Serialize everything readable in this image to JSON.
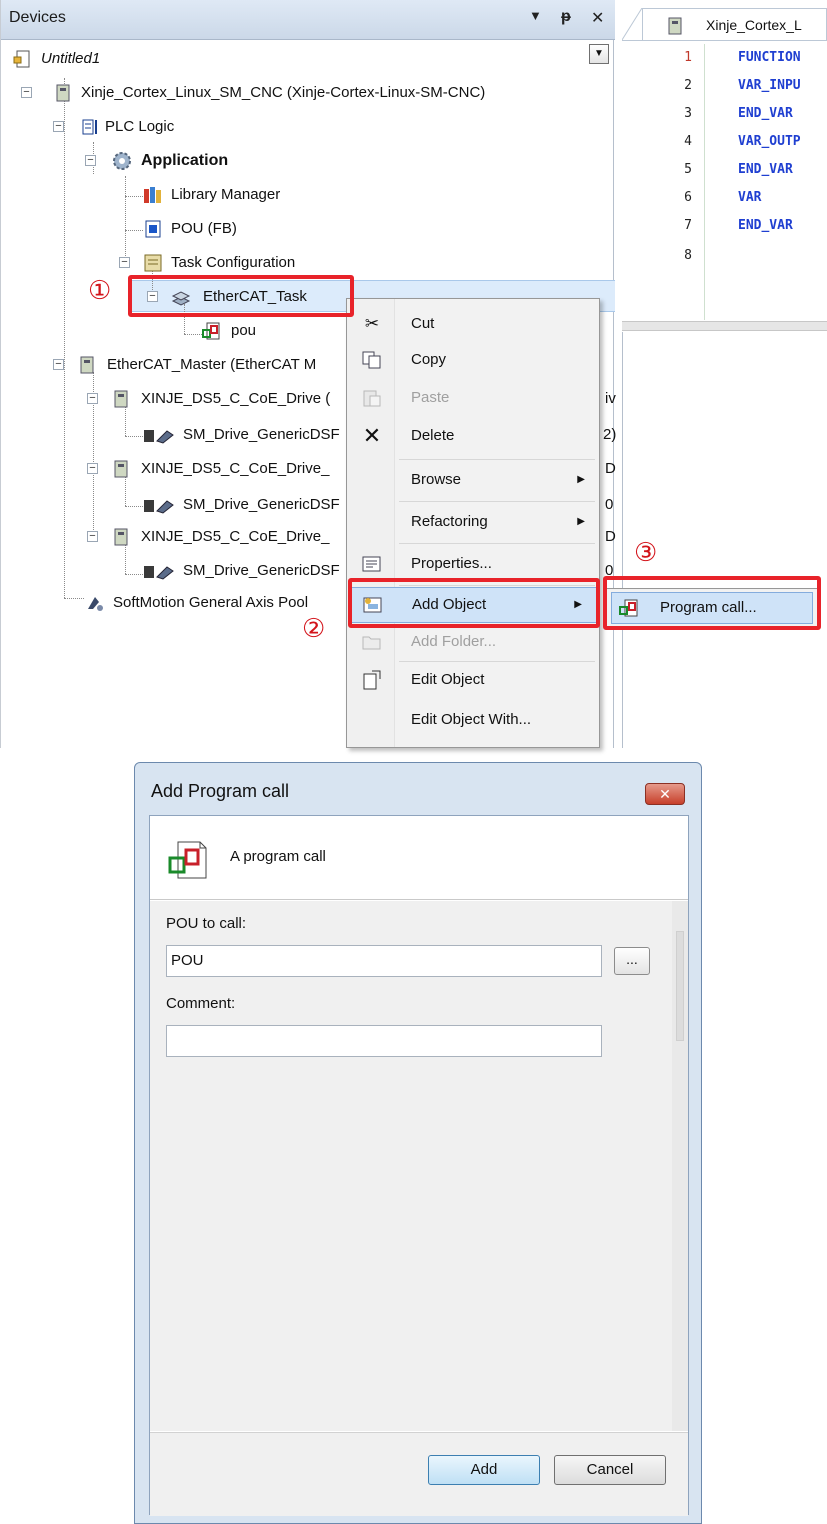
{
  "devices_panel": {
    "title": "Devices",
    "pin_glyph": "⬇ ґ",
    "close_glyph": "✕",
    "tree": {
      "untitled": "Untitled1",
      "device": "Xinje_Cortex_Linux_SM_CNC (Xinje-Cortex-Linux-SM-CNC)",
      "plc_logic": "PLC Logic",
      "application": "Application",
      "library_manager": "Library Manager",
      "pou_fb": "POU (FB)",
      "task_configuration": "Task Configuration",
      "ethercat_task": "EtherCAT_Task",
      "pou": "pou",
      "ethercat_master": "EtherCAT_Master (EtherCAT M",
      "drive_1": "XINJE_DS5_C_CoE_Drive (",
      "drive_1_tail": "iv",
      "sm_drive_1": "SM_Drive_GenericDSF",
      "sm_drive_1_tail": "2)",
      "drive_2": "XINJE_DS5_C_CoE_Drive_",
      "drive_2_tail": "D",
      "sm_drive_2": "SM_Drive_GenericDSF",
      "sm_drive_2_tail": "0",
      "drive_3": "XINJE_DS5_C_CoE_Drive_",
      "drive_3_tail": "D",
      "sm_drive_3": "SM_Drive_GenericDSF",
      "sm_drive_3_tail": "0",
      "axis_pool": "SoftMotion General Axis Pool"
    }
  },
  "editor": {
    "tab_title": "Xinje_Cortex_L",
    "lines": [
      {
        "n": "1",
        "text": "FUNCTION"
      },
      {
        "n": "2",
        "text": "VAR_INPU"
      },
      {
        "n": "3",
        "text": "END_VAR"
      },
      {
        "n": "4",
        "text": "VAR_OUTP"
      },
      {
        "n": "5",
        "text": "END_VAR"
      },
      {
        "n": "6",
        "text": "VAR"
      },
      {
        "n": "7",
        "text": "END_VAR"
      },
      {
        "n": "8",
        "text": ""
      }
    ]
  },
  "context_menu": {
    "cut": "Cut",
    "copy": "Copy",
    "paste": "Paste",
    "delete": "Delete",
    "browse": "Browse",
    "refactoring": "Refactoring",
    "properties": "Properties...",
    "add_object": "Add Object",
    "add_folder": "Add Folder...",
    "edit_object": "Edit Object",
    "edit_object_with": "Edit Object With..."
  },
  "submenu": {
    "program_call": "Program call..."
  },
  "markers": {
    "step1": "①",
    "step2": "②",
    "step3": "③"
  },
  "dialog": {
    "title": "Add Program call",
    "close_glyph": "✕",
    "header_text": "A program call",
    "pou_label": "POU to call:",
    "pou_value": "POU",
    "browse_label": "...",
    "comment_label": "Comment:",
    "comment_value": "",
    "add_button": "Add",
    "cancel_button": "Cancel"
  },
  "colors": {
    "highlight_red": "#e8232a",
    "keyword_blue": "#1f3fd1",
    "selection_blue": "#cfe3f8"
  }
}
